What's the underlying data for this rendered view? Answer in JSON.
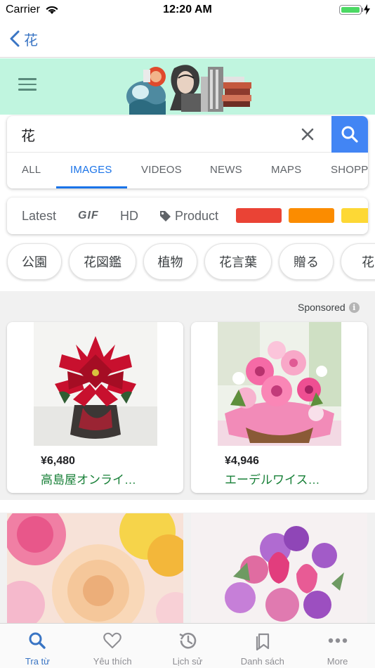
{
  "status_bar": {
    "carrier": "Carrier",
    "time": "12:20 AM",
    "battery_level": 1.0
  },
  "nav": {
    "back_title": "花"
  },
  "search": {
    "query": "花",
    "icons": {
      "clear": "close-icon",
      "submit": "search-icon"
    }
  },
  "tabs": [
    {
      "label": "ALL",
      "active": false
    },
    {
      "label": "IMAGES",
      "active": true
    },
    {
      "label": "VIDEOS",
      "active": false
    },
    {
      "label": "NEWS",
      "active": false
    },
    {
      "label": "MAPS",
      "active": false
    },
    {
      "label": "SHOPPING",
      "active": false
    }
  ],
  "filters": {
    "latest": "Latest",
    "gif": "GIF",
    "hd": "HD",
    "product": "Product",
    "color_swatches": [
      "#ea4335",
      "#fb8c00",
      "#fdd835"
    ]
  },
  "chips": [
    "公園",
    "花図鑑",
    "植物",
    "花言葉",
    "贈る",
    "花束"
  ],
  "sponsored": {
    "label": "Sponsored",
    "info_icon": "i"
  },
  "ads": [
    {
      "price": "¥6,480",
      "store": "高島屋オンライ…"
    },
    {
      "price": "¥4,946",
      "store": "エーデルワイス…"
    }
  ],
  "tab_bar": [
    {
      "label": "Tra từ",
      "icon": "search-icon",
      "active": true
    },
    {
      "label": "Yêu thích",
      "icon": "heart-icon",
      "active": false
    },
    {
      "label": "Lịch sử",
      "icon": "history-icon",
      "active": false
    },
    {
      "label": "Danh sách",
      "icon": "bookmarks-icon",
      "active": false
    },
    {
      "label": "More",
      "icon": "more-icon",
      "active": false
    }
  ],
  "colors": {
    "accent": "#1a73e8",
    "ios_tint": "#3a75c4",
    "header_bg": "#c0f5df",
    "search_button": "#4285f4",
    "store_link": "#188038"
  }
}
